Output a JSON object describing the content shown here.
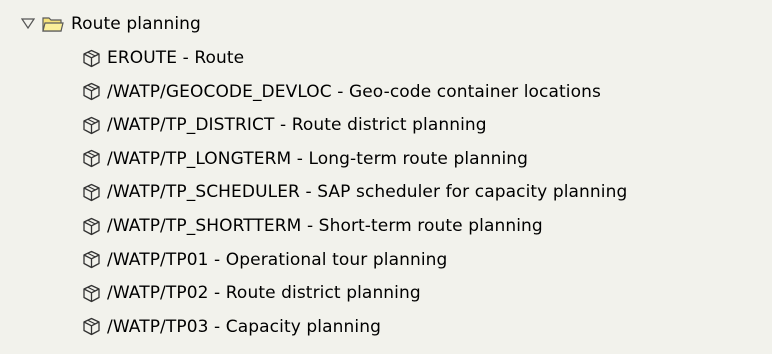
{
  "tree": {
    "folder": {
      "label": "Route planning",
      "expanded": true,
      "icon": "folder-open-icon",
      "toggle_icon": "triangle-down-icon"
    },
    "item_icon": "cube-icon",
    "items": [
      {
        "label": "EROUTE - Route"
      },
      {
        "label": "/WATP/GEOCODE_DEVLOC - Geo-code container locations"
      },
      {
        "label": "/WATP/TP_DISTRICT - Route district planning"
      },
      {
        "label": "/WATP/TP_LONGTERM - Long-term route planning"
      },
      {
        "label": "/WATP/TP_SCHEDULER - SAP scheduler for capacity planning"
      },
      {
        "label": "/WATP/TP_SHORTTERM - Short-term route planning"
      },
      {
        "label": "/WATP/TP01 - Operational tour planning"
      },
      {
        "label": "/WATP/TP02 - Route district planning"
      },
      {
        "label": "/WATP/TP03 - Capacity planning"
      }
    ]
  },
  "colors": {
    "background": "#f2f2ec",
    "folder_fill": "#f6e27a",
    "folder_stroke": "#5a5a5a",
    "icon_stroke": "#333333"
  }
}
